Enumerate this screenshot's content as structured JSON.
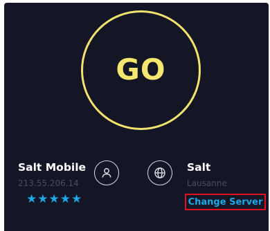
{
  "go_button": {
    "label": "GO"
  },
  "provider": {
    "name": "Salt Mobile",
    "ip": "213.55.206.14",
    "rating_stars": "★★★★★"
  },
  "server": {
    "name": "Salt",
    "location": "Lausanne",
    "change_label": "Change Server"
  },
  "colors": {
    "background": "#141626",
    "go_ring": "#f2e36e",
    "accent": "#1ea9e6",
    "highlight_border": "#e1121e"
  },
  "icons": {
    "provider": "user-icon",
    "server": "globe-icon"
  }
}
